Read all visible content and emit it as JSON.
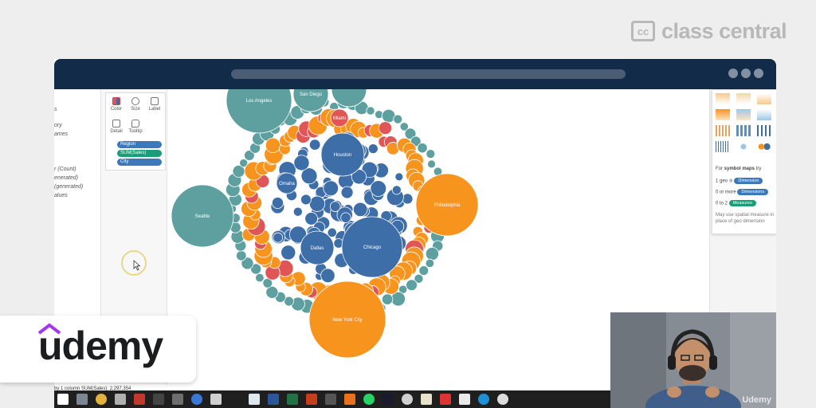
{
  "brand": {
    "cc_mark": "cc",
    "cc_text": "class central"
  },
  "udemy": {
    "logo_text": "udemy"
  },
  "left_pane": {
    "items": [
      "s",
      "ory",
      "ames",
      "r (Count)",
      "enerated)",
      "(generated)",
      "alues"
    ]
  },
  "marks": {
    "buttons": [
      {
        "label": "Color",
        "icon": "color-icon"
      },
      {
        "label": "Size",
        "icon": "size-icon"
      },
      {
        "label": "Label",
        "icon": "label-icon"
      },
      {
        "label": "Detail",
        "icon": "detail-icon"
      },
      {
        "label": "Tooltip",
        "icon": "tooltip-icon"
      }
    ],
    "pills": [
      {
        "label": "Region",
        "color": "#3d78b8"
      },
      {
        "label": "SUM(Sales)",
        "color": "#1a9e77"
      },
      {
        "label": "City",
        "color": "#3d78b8"
      }
    ]
  },
  "viz": {
    "labels": {
      "los_angeles": "Los Angeles",
      "san_diego": "San Diego",
      "miami": "Miami",
      "houston": "Houston",
      "omaha": "Omaha",
      "seattle": "Seattle",
      "philadelphia": "Philadelphia",
      "dallas": "Dallas",
      "chicago": "Chicago",
      "new_york_city": "New York City"
    },
    "colors": {
      "teal": "#5e9fa0",
      "blue": "#3e6ea8",
      "orange": "#f7941d",
      "red": "#e05656"
    }
  },
  "show_me": {
    "title_prefix": "For ",
    "title_bold": "symbol maps",
    "title_suffix": " try",
    "rows": [
      {
        "prefix": "1 geo",
        "pill": "Dimension",
        "color": "#3d78b8"
      },
      {
        "prefix": "0 or more",
        "pill": "Dimensions",
        "color": "#3d78b8"
      },
      {
        "prefix": "0 to 2",
        "pill": "Measures",
        "color": "#1a9e77"
      }
    ],
    "note1": "May use spatial measure in",
    "note2": "place of geo dimension"
  },
  "status": {
    "text": "by 1 column    SUM(Sales): 2,297,354"
  },
  "webcam": {
    "watermark": "Udemy"
  }
}
